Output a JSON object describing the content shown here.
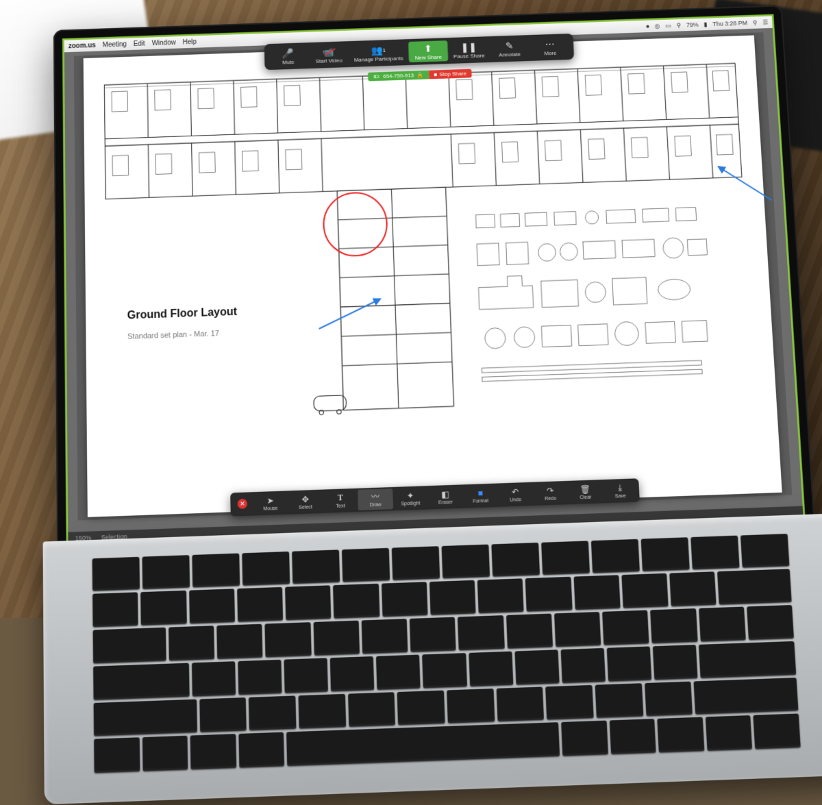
{
  "menubar": {
    "app": "zoom.us",
    "items": [
      "Meeting",
      "Edit",
      "Window",
      "Help"
    ],
    "battery": "79%",
    "clock": "Thu 3:28 PM"
  },
  "zoom_toolbar": {
    "mute": "Mute",
    "start_video": "Start Video",
    "manage_participants": "Manage Participants",
    "participant_count": "1",
    "new_share": "New Share",
    "pause_share": "Pause Share",
    "annotate": "Annotate",
    "more": "More"
  },
  "share_bar": {
    "id_label": "ID:",
    "meeting_id": "654-750-913",
    "stop_share": "Stop Share"
  },
  "annotation_toolbar": {
    "mouse": "Mouse",
    "select": "Select",
    "text": "Text",
    "draw": "Draw",
    "spotlight": "Spotlight",
    "eraser": "Eraser",
    "format": "Format",
    "undo": "Undo",
    "redo": "Redo",
    "clear": "Clear",
    "save": "Save"
  },
  "document": {
    "title": "Ground Floor Layout",
    "subtitle": "Standard set plan - Mar. 17"
  },
  "statusbar": {
    "zoom": "150%",
    "mode": "Selection"
  }
}
